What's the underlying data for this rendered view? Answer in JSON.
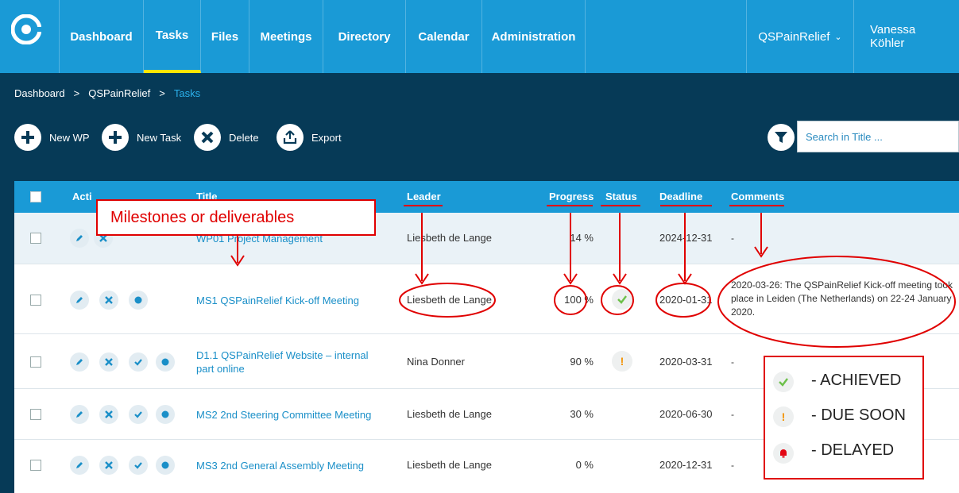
{
  "nav": {
    "items": [
      "Dashboard",
      "Tasks",
      "Files",
      "Meetings",
      "Directory",
      "Calendar",
      "Administration"
    ],
    "project": "QSPainRelief",
    "user": "Vanessa Köhler"
  },
  "breadcrumb": [
    "Dashboard",
    "QSPainRelief",
    "Tasks"
  ],
  "toolbar": {
    "new_wp": "New WP",
    "new_task": "New Task",
    "delete": "Delete",
    "export": "Export",
    "search_placeholder": "Search in Title ..."
  },
  "table": {
    "headers": {
      "actions": "Acti",
      "title": "Title",
      "leader": "Leader",
      "progress": "Progress",
      "status": "Status",
      "deadline": "Deadline",
      "comments": "Comments"
    },
    "rows": [
      {
        "title": "WP01 Project Management",
        "leader": "Liesbeth de Lange",
        "progress": "14 %",
        "status": "",
        "deadline": "2024-12-31",
        "comment": "-"
      },
      {
        "title": "MS1 QSPainRelief Kick-off Meeting",
        "leader": "Liesbeth de Lange",
        "progress": "100 %",
        "status": "achieved",
        "deadline": "2020-01-31",
        "comment": "2020-03-26: The QSPainRelief Kick-off meeting took place in Leiden (The Netherlands) on 22-24 January 2020."
      },
      {
        "title": "D1.1 QSPainRelief Website – internal part online",
        "leader": "Nina Donner",
        "progress": "90 %",
        "status": "due-soon",
        "deadline": "2020-03-31",
        "comment": "-"
      },
      {
        "title": "MS2 2nd Steering Committee Meeting",
        "leader": "Liesbeth de Lange",
        "progress": "30 %",
        "status": "",
        "deadline": "2020-06-30",
        "comment": "-"
      },
      {
        "title": "MS3 2nd General Assembly Meeting",
        "leader": "Liesbeth de Lange",
        "progress": "0 %",
        "status": "",
        "deadline": "2020-12-31",
        "comment": "-"
      }
    ]
  },
  "annotation": {
    "milestones_label": "Milestones or deliverables",
    "legend": {
      "achieved": "- ACHIEVED",
      "due_soon": "- DUE SOON",
      "delayed": "- DELAYED"
    }
  },
  "colors": {
    "nav_bg": "#1a9ad6",
    "band_bg": "#063a57",
    "active_underline": "#ffe600",
    "link": "#1a8fc8",
    "annotation_red": "#e00000",
    "achieved": "#6cc04a",
    "due_soon": "#f39200",
    "delayed": "#e30613"
  }
}
